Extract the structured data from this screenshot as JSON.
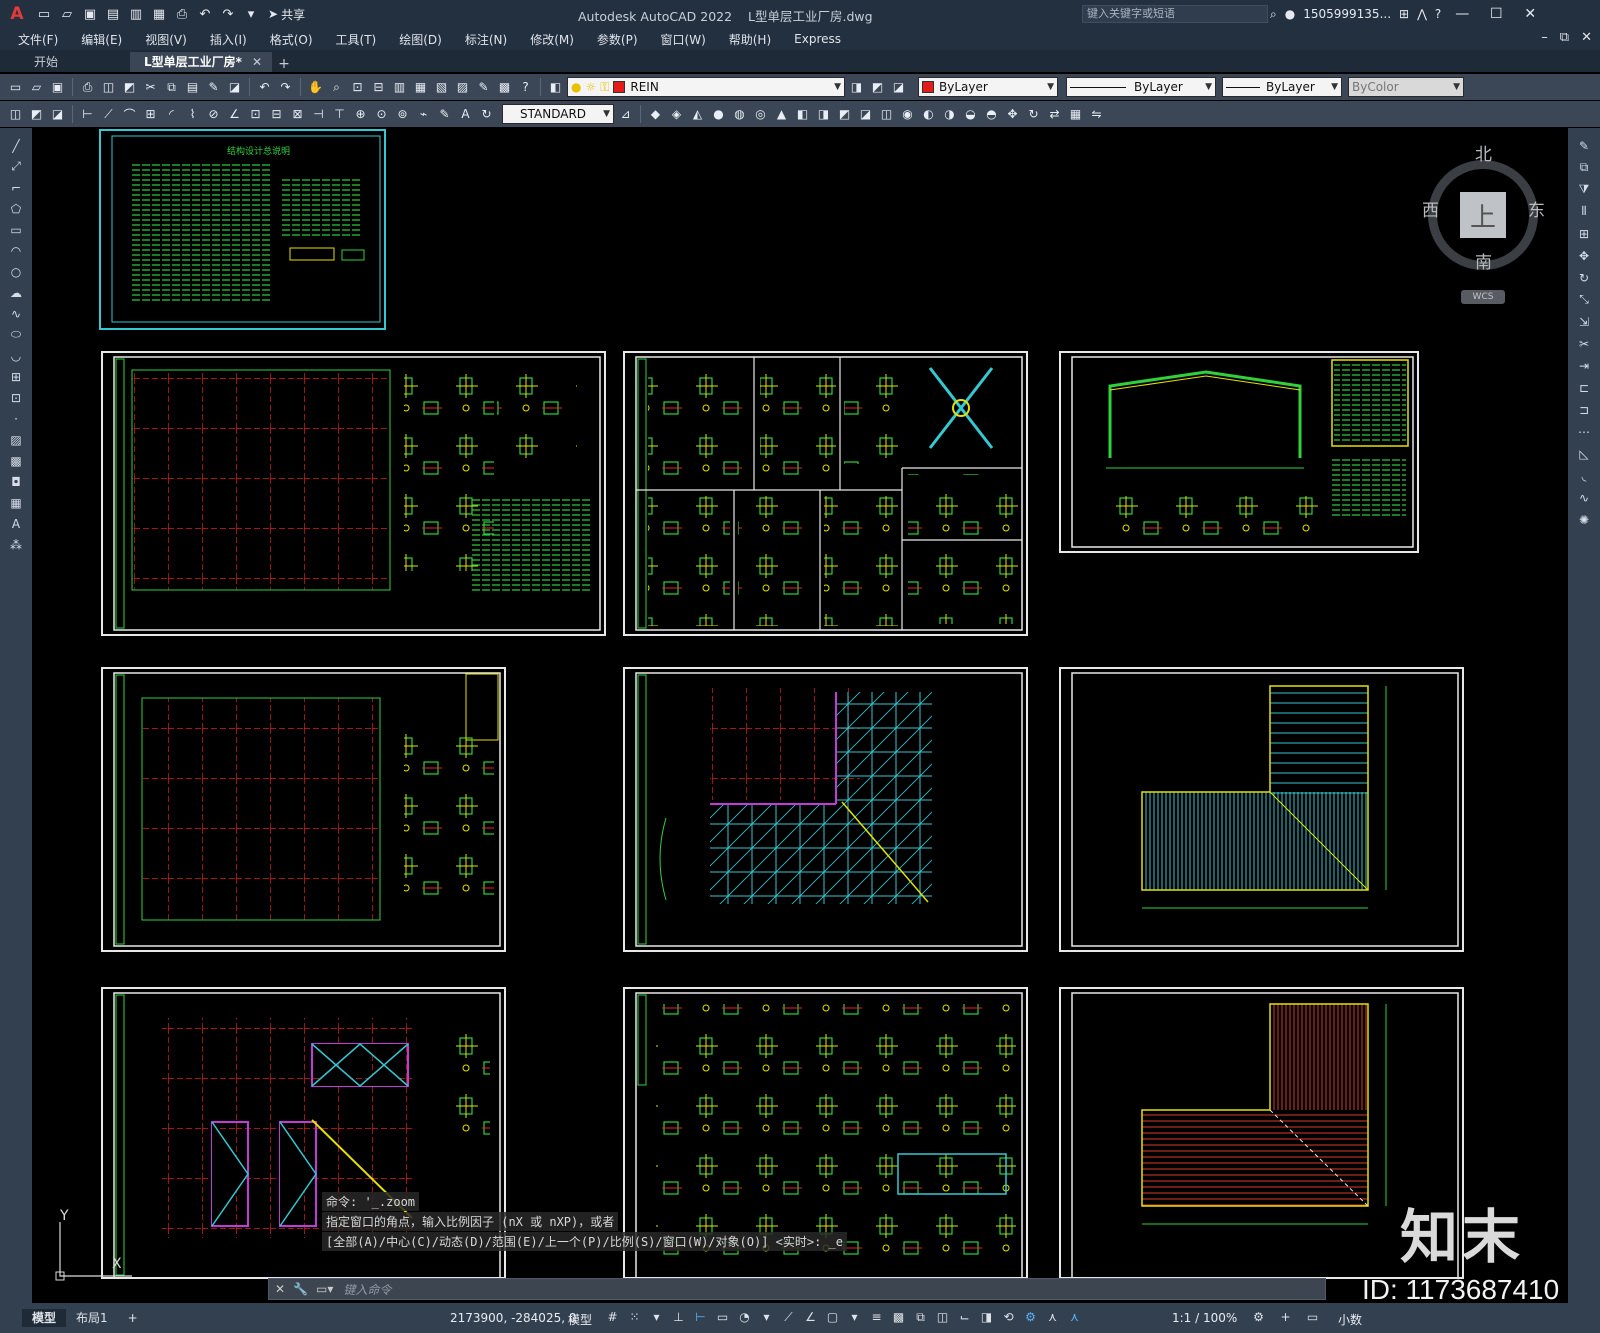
{
  "app": {
    "title": "Autodesk AutoCAD 2022",
    "filename": "L型单层工业厂房.dwg",
    "share_label": "共享",
    "search_placeholder": "键入关键字或短语",
    "user": "1505999135..."
  },
  "menu": [
    "文件(F)",
    "编辑(E)",
    "视图(V)",
    "插入(I)",
    "格式(O)",
    "工具(T)",
    "绘图(D)",
    "标注(N)",
    "修改(M)",
    "参数(P)",
    "窗口(W)",
    "帮助(H)",
    "Express"
  ],
  "tabs": {
    "start": "开始",
    "active": "L型单层工业厂房*"
  },
  "properties": {
    "layer": "REIN",
    "color": "ByLayer",
    "linetype": "ByLayer",
    "lineweight": "ByLayer",
    "plotstyle": "ByColor",
    "textstyle": "STANDARD",
    "layer_color": "#e31b1b"
  },
  "viewcube": {
    "north": "北",
    "south": "南",
    "east": "东",
    "west": "西",
    "face": "上",
    "wcs": "WCS"
  },
  "command": {
    "history": [
      "命令: '_.zoom",
      "指定窗口的角点，输入比例因子 (nX 或 nXP)，或者",
      "[全部(A)/中心(C)/动态(D)/范围(E)/上一个(P)/比例(S)/窗口(W)/对象(O)] <实时>: _e"
    ],
    "placeholder": "键入命令"
  },
  "ucs": {
    "y_label": "Y",
    "x_label": "X"
  },
  "sheets": {
    "cover_title": "结构设计总说明"
  },
  "status": {
    "layout_tabs": [
      "模型",
      "布局1"
    ],
    "coordinates": "2173900, -284025, 0",
    "space": "模型",
    "scale": "1:1 / 100%",
    "units": "小数"
  },
  "watermark": {
    "logo": "知末",
    "id": "ID: 1173687410"
  }
}
